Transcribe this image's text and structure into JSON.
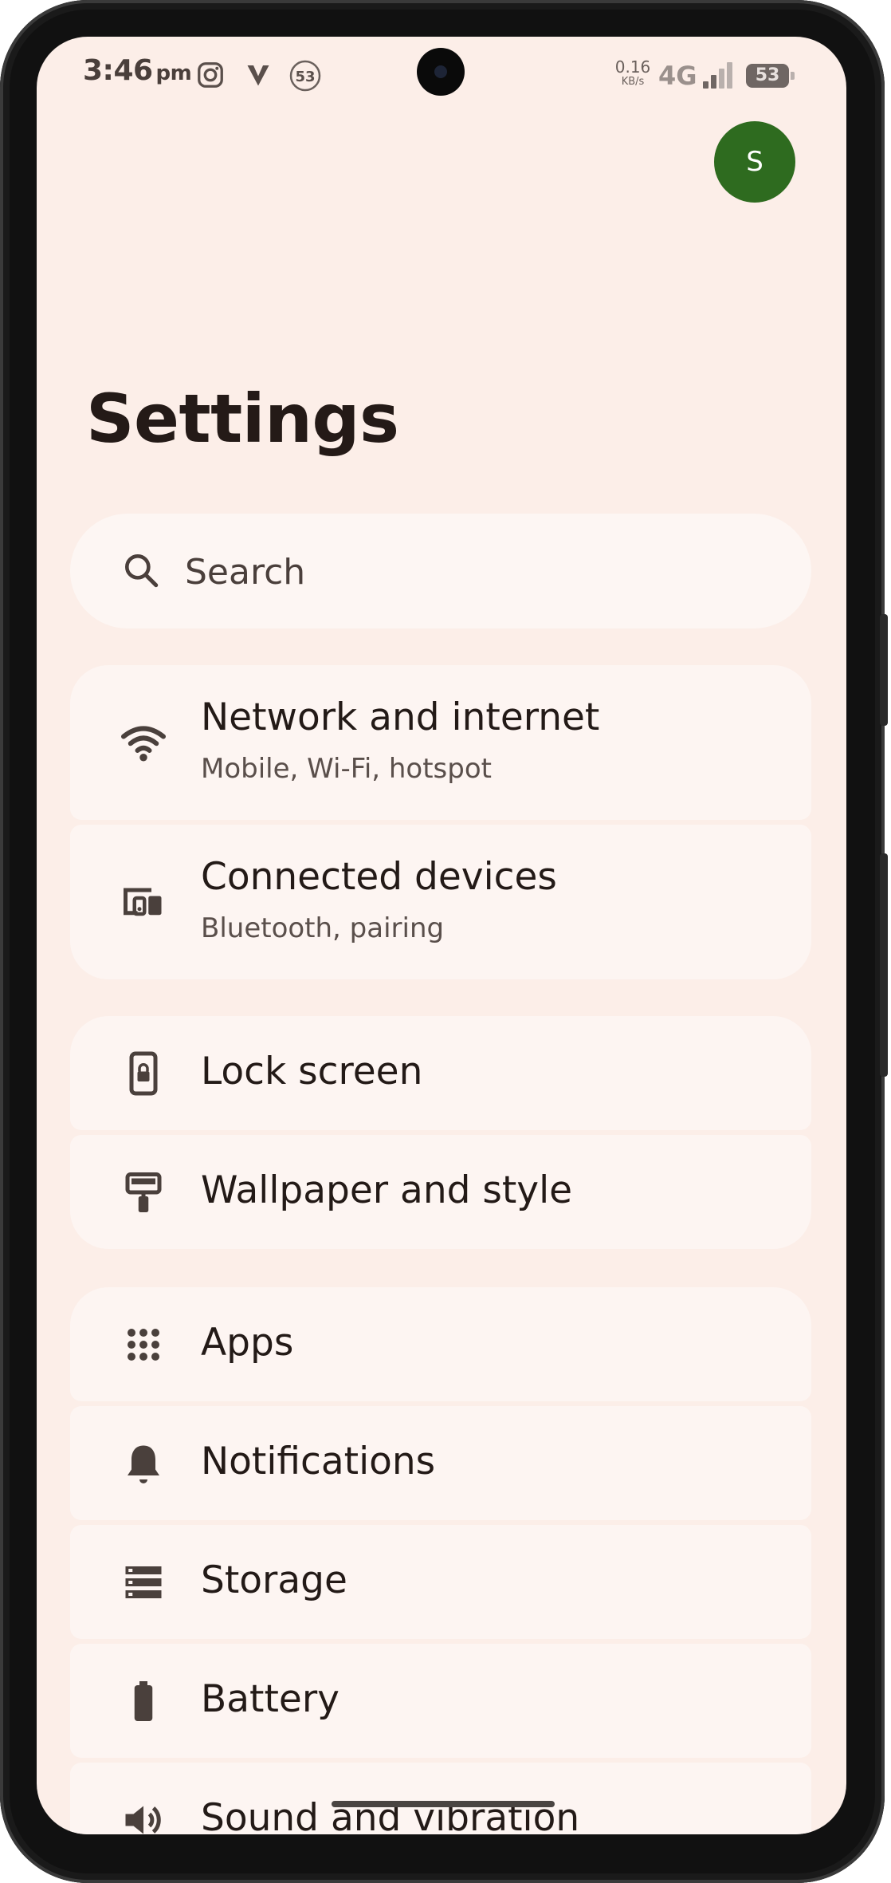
{
  "status_bar": {
    "time": "3:46",
    "ampm": "pm",
    "netspeed_value": "0.16",
    "netspeed_unit": "KB/s",
    "network_type": "4G",
    "battery": "53",
    "notif_count": "53",
    "icons": [
      "instagram-icon",
      "v-app-icon",
      "notification-count-icon",
      "signal-icon",
      "battery-icon"
    ]
  },
  "profile": {
    "initial": "S",
    "color": "#2e6b1f"
  },
  "page": {
    "title": "Settings"
  },
  "search": {
    "placeholder": "Search",
    "value": ""
  },
  "groups": [
    {
      "items": [
        {
          "title": "Network and internet",
          "subtitle": "Mobile, Wi-Fi, hotspot",
          "icon": "wifi-icon"
        },
        {
          "title": "Connected devices",
          "subtitle": "Bluetooth, pairing",
          "icon": "devices-icon"
        }
      ]
    },
    {
      "items": [
        {
          "title": "Lock screen",
          "icon": "lock-screen-icon"
        },
        {
          "title": "Wallpaper and style",
          "icon": "paint-roller-icon"
        }
      ]
    },
    {
      "items": [
        {
          "title": "Apps",
          "icon": "apps-grid-icon"
        },
        {
          "title": "Notifications",
          "icon": "bell-icon"
        },
        {
          "title": "Storage",
          "icon": "storage-icon"
        },
        {
          "title": "Battery",
          "icon": "battery-icon"
        },
        {
          "title": "Sound and vibration",
          "icon": "speaker-icon"
        }
      ]
    }
  ],
  "colors": {
    "background": "#fceee8",
    "card": "#fdf5f2",
    "text": "#231a17",
    "accent_avatar": "#2e6b1f"
  }
}
